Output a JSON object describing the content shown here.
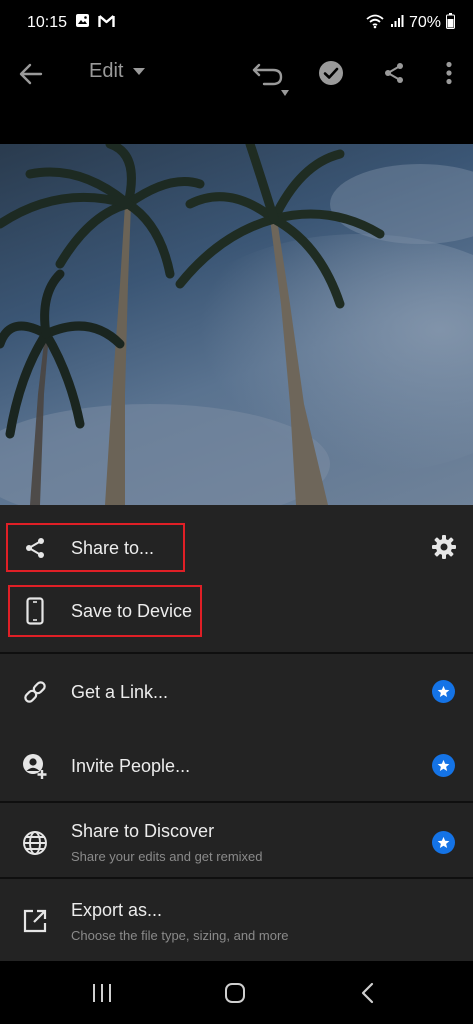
{
  "status": {
    "time": "10:15",
    "battery": "70%"
  },
  "toolbar": {
    "mode_label": "Edit"
  },
  "share_sheet": {
    "share_to": "Share to...",
    "save_to_device": "Save to Device",
    "get_link": "Get a Link...",
    "invite_people": "Invite People...",
    "share_to_discover": "Share to Discover",
    "share_to_discover_sub": "Share your edits and get remixed",
    "export_as": "Export as...",
    "export_as_sub": "Choose the file type, sizing, and more"
  },
  "colors": {
    "accent": "#1473e6",
    "highlight": "#e01f26",
    "sheet_bg": "#232323"
  }
}
